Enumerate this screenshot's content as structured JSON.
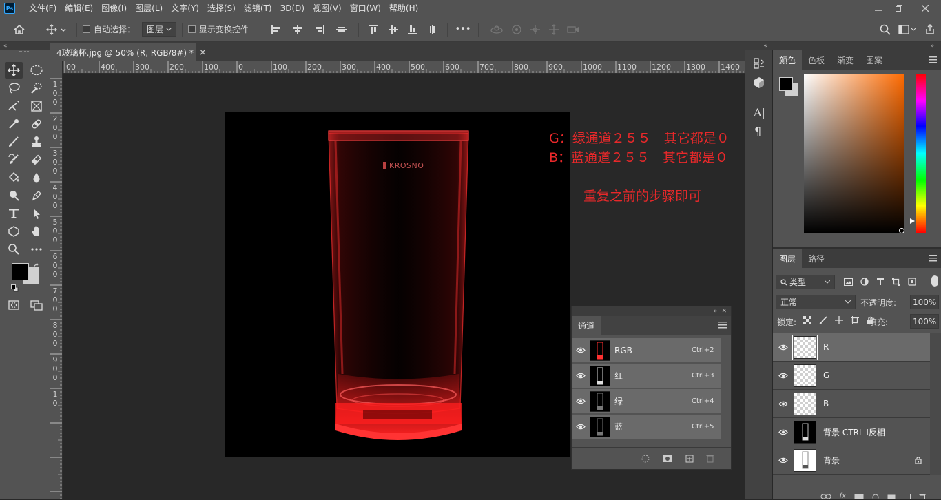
{
  "app": {
    "logo": "Ps"
  },
  "menubar": {
    "items": [
      "文件(F)",
      "编辑(E)",
      "图像(I)",
      "图层(L)",
      "文字(Y)",
      "选择(S)",
      "滤镜(T)",
      "3D(D)",
      "视图(V)",
      "窗口(W)",
      "帮助(H)"
    ],
    "window_buttons": [
      "minimize-icon",
      "restore-icon",
      "close-icon"
    ]
  },
  "options_bar": {
    "auto_select_label": "自动选择：",
    "auto_select_target": "图层",
    "show_transform_label": "显示变换控件",
    "more_label": "•••",
    "mode_3d_label": "3D 模式："
  },
  "document_tab": {
    "title": "4玻璃杯.jpg @ 50% (R, RGB/8#) *",
    "close": "×"
  },
  "rulers": {
    "top": [
      "00",
      "400",
      "300",
      "200",
      "100",
      "0",
      "100",
      "200",
      "300",
      "400",
      "500",
      "600",
      "700",
      "800",
      "900",
      "1000",
      "1100",
      "1200",
      "1300",
      "1400"
    ],
    "left": [
      "1",
      "0",
      "0",
      "2",
      "0",
      "0",
      "3",
      "0",
      "0",
      "4",
      "0",
      "0",
      "5",
      "0",
      "0",
      "6",
      "0",
      "0",
      "7",
      "0",
      "0",
      "8",
      "0",
      "0",
      "9",
      "0",
      "0",
      "1",
      "0"
    ]
  },
  "canvas": {
    "brand_text": "KROSNO",
    "annotations": [
      "G：绿通道２５５　其它都是０",
      "B：蓝通道２５５　其它都是０",
      "重复之前的步骤即可"
    ],
    "annotation_color": "#e8282a",
    "glass_color": "#ff2a2a"
  },
  "channels_panel": {
    "tab": "通道",
    "channels": [
      {
        "name": "RGB",
        "shortcut": "Ctrl+2"
      },
      {
        "name": "红",
        "shortcut": "Ctrl+3"
      },
      {
        "name": "绿",
        "shortcut": "Ctrl+4"
      },
      {
        "name": "蓝",
        "shortcut": "Ctrl+5"
      }
    ]
  },
  "color_panel": {
    "tabs": [
      "颜色",
      "色板",
      "渐变",
      "图案"
    ],
    "hue_color": "#ff6a00"
  },
  "layers_panel": {
    "tabs": [
      "图层",
      "路径"
    ],
    "filter_label": "类型",
    "blend_mode": "正常",
    "opacity_label": "不透明度:",
    "opacity_value": "100%",
    "lock_label": "锁定:",
    "fill_label": "填充:",
    "fill_value": "100%",
    "layers": [
      {
        "name": "R",
        "selected": true
      },
      {
        "name": "G",
        "selected": false
      },
      {
        "name": "B",
        "selected": false
      },
      {
        "name": "背景 CTRL I反相",
        "selected": false
      },
      {
        "name": "背景",
        "selected": false,
        "locked": true
      }
    ]
  }
}
